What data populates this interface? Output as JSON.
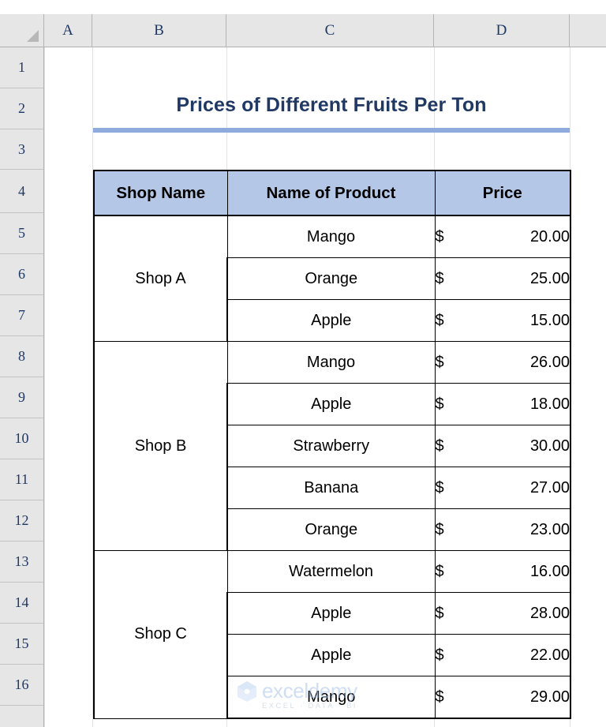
{
  "app": {
    "type": "spreadsheet",
    "corner_icon": "select-all-triangle-icon"
  },
  "grid": {
    "column_headers": [
      "A",
      "B",
      "C",
      "D"
    ],
    "row_headers": [
      "1",
      "2",
      "3",
      "4",
      "5",
      "6",
      "7",
      "8",
      "9",
      "10",
      "11",
      "12",
      "13",
      "14",
      "15",
      "16"
    ]
  },
  "title": {
    "text": "Prices of Different Fruits Per Ton",
    "color": "#1f3864",
    "rule_color": "#8faadc"
  },
  "table": {
    "header_fill": "#b4c7e7",
    "headers": [
      "Shop Name",
      "Name of Product",
      "Price"
    ],
    "currency_symbol": "$",
    "groups": [
      {
        "shop": "Shop A",
        "rows": [
          {
            "product": "Mango",
            "price": "20.00"
          },
          {
            "product": "Orange",
            "price": "25.00"
          },
          {
            "product": "Apple",
            "price": "15.00"
          }
        ]
      },
      {
        "shop": "Shop B",
        "rows": [
          {
            "product": "Mango",
            "price": "26.00"
          },
          {
            "product": "Apple",
            "price": "18.00"
          },
          {
            "product": "Strawberry",
            "price": "30.00"
          },
          {
            "product": "Banana",
            "price": "27.00"
          },
          {
            "product": "Orange",
            "price": "23.00"
          }
        ]
      },
      {
        "shop": "Shop C",
        "rows": [
          {
            "product": "Watermelon",
            "price": "16.00"
          },
          {
            "product": "Apple",
            "price": "28.00"
          },
          {
            "product": "Apple",
            "price": "22.00"
          },
          {
            "product": "Mango",
            "price": "29.00"
          }
        ]
      }
    ]
  },
  "watermark": {
    "brand": "exceldemy",
    "tagline": "EXCEL · DATA · BI",
    "color": "#a9c4ea"
  }
}
